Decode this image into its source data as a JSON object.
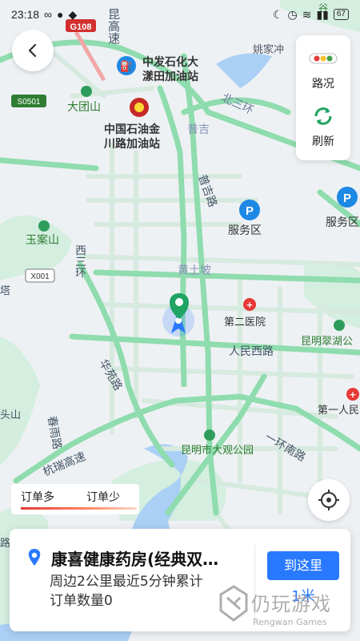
{
  "status_bar": {
    "time": "23:18",
    "battery": "67"
  },
  "map": {
    "labels": {
      "road_g108": "G108",
      "kunming_highway": "昆高速",
      "s0501": "S0501",
      "x001": "X001",
      "gas_zhongfa": "中发石化大漾田加油站",
      "gas_zhongfa_l1": "中发石化大",
      "gas_zhongfa_l2": "漾田加油站",
      "gas_cnpc_l1": "中国石油金",
      "gas_cnpc_l2": "川路加油站",
      "datuanshan": "大团山",
      "yaojiachong": "姚家冲",
      "north_ring": "北三环",
      "puji": "普吉",
      "puji_road": "普吉路",
      "service_area_1": "服务区",
      "service_area_2": "服务区",
      "yuanshan": "玉案山",
      "west_ring": "西三环",
      "huangtupo": "黄土坡",
      "second_hospital": "第二医院",
      "cuihu": "昆明翠湖公",
      "renmin_west": "人民西路",
      "huayuan_road": "华苑路",
      "first_people": "第一人民",
      "chunyu_road": "春雨路",
      "hangrui_highway": "杭瑞高速",
      "daguan_park": "昆明市大观公园",
      "first_ring_south": "一环南路",
      "gu_label": "谷",
      "ta_label": "塔",
      "toushan": "头山",
      "lu_label": "路"
    }
  },
  "controls": {
    "traffic_label": "路况",
    "refresh_label": "刷新"
  },
  "legend": {
    "more": "订单多",
    "less": "订单少"
  },
  "card": {
    "title": "康喜健康药房(经典双…",
    "desc_line1": "周边2公里最近5分钟累计",
    "desc_line2": "订单数量0",
    "goto_label": "到这里",
    "distance": "1米"
  },
  "watermark": {
    "cn": "仍玩游戏",
    "en": "Rengwan Games"
  },
  "colors": {
    "road": "#8fdcae",
    "road_edge": "#d0eedb",
    "water": "#abd0f5",
    "green": "#cdeedb",
    "accent": "#2979ff",
    "pin_green": "#1fa463",
    "hospital": "#e53935"
  }
}
